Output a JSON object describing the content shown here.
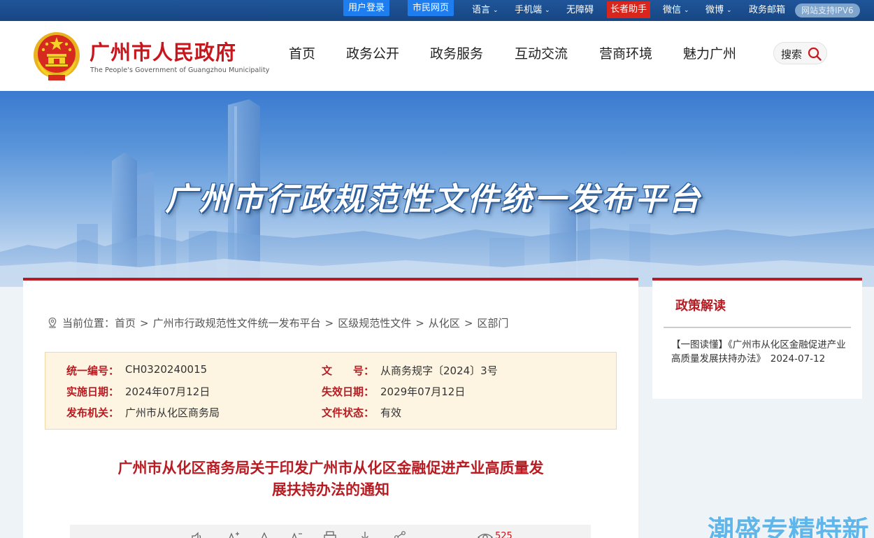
{
  "topbar": {
    "user_login": "用户登录",
    "citizen_page": "市民网页",
    "language": "语言",
    "mobile": "手机端",
    "accessibility": "无障碍",
    "elder_helper": "长者助手",
    "wechat": "微信",
    "weibo": "微博",
    "gov_mail": "政务邮箱",
    "ipv6": "网站支持IPV6"
  },
  "header": {
    "title": "广州市人民政府",
    "subtitle": "The People's Government of Guangzhou Municipality",
    "nav": [
      "首页",
      "政务公开",
      "政务服务",
      "互动交流",
      "营商环境",
      "魅力广州"
    ],
    "search_label": "搜索"
  },
  "banner": {
    "title": "广州市行政规范性文件统一发布平台"
  },
  "breadcrumb": {
    "prefix": "当前位置：",
    "items": [
      "首页",
      "广州市行政规范性文件统一发布平台",
      "区级规范性文件",
      "从化区",
      "区部门"
    ],
    "separator": ">"
  },
  "info": {
    "code_key": "统一编号：",
    "code_val": "CH0320240015",
    "docno_key": "文　　号：",
    "docno_val": "从商务规字〔2024〕3号",
    "start_key": "实施日期：",
    "start_val": "2024年07月12日",
    "end_key": "失效日期：",
    "end_val": "2029年07月12日",
    "issuer_key": "发布机关：",
    "issuer_val": "广州市从化区商务局",
    "status_key": "文件状态：",
    "status_val": "有效"
  },
  "document": {
    "title_line1": "广州市从化区商务局关于印发广州市从化区金融促进产业高质量发",
    "title_line2": "展扶持办法的通知",
    "views": "525"
  },
  "side": {
    "heading": "政策解读",
    "item_text": "【一图读懂】《广州市从化区金融促进产业高质量发展扶持办法》　2024-07-12"
  },
  "watermark": "潮盛专精特新",
  "colors": {
    "topbar": "#1a4d8f",
    "brand_red": "#c8161d",
    "info_bg": "#fdf5e2"
  }
}
